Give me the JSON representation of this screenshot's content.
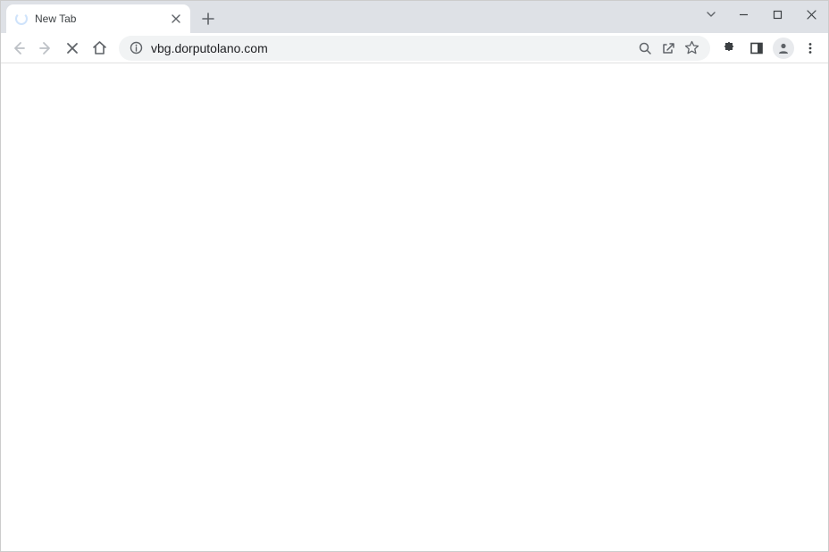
{
  "tab": {
    "title": "New Tab"
  },
  "omnibox": {
    "url": "vbg.dorputolano.com"
  }
}
